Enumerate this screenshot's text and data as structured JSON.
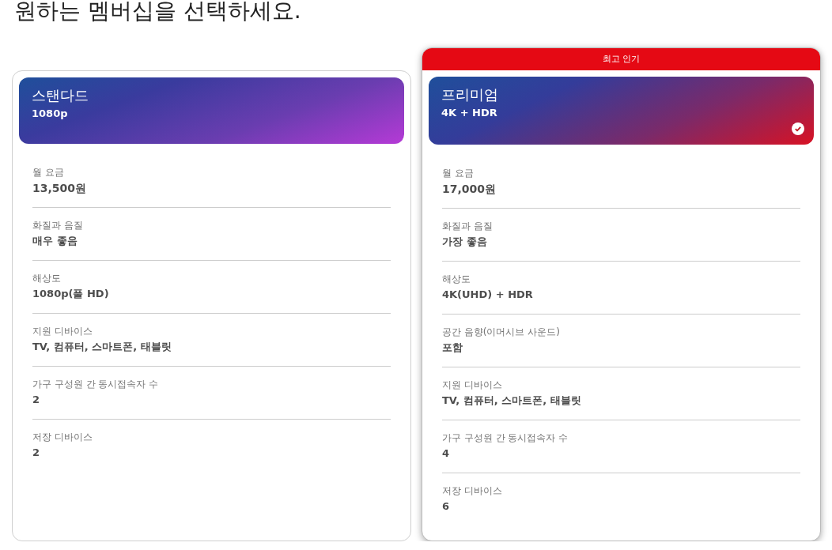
{
  "heading": "원하는 멤버십을 선택하세요.",
  "plans": [
    {
      "kind": "standard",
      "name": "스탠다드",
      "resolution": "1080p",
      "selected": false,
      "rows": [
        {
          "label": "월 요금",
          "value": "13,500원",
          "kind": "price"
        },
        {
          "label": "화질과 음질",
          "value": "매우 좋음"
        },
        {
          "label": "해상도",
          "value": "1080p(풀 HD)"
        },
        {
          "label": "지원 디바이스",
          "value": "TV, 컴퓨터, 스마트폰, 태블릿"
        },
        {
          "label": "가구 구성원 간 동시접속자 수",
          "value": "2"
        },
        {
          "label": "저장 디바이스",
          "value": "2"
        }
      ]
    },
    {
      "kind": "premium",
      "badge": "최고 인기",
      "name": "프리미엄",
      "resolution": "4K + HDR",
      "selected": true,
      "rows": [
        {
          "label": "월 요금",
          "value": "17,000원",
          "kind": "price"
        },
        {
          "label": "화질과 음질",
          "value": "가장 좋음"
        },
        {
          "label": "해상도",
          "value": "4K(UHD) + HDR"
        },
        {
          "label": "공간 음향(이머시브 사운드)",
          "value": "포함"
        },
        {
          "label": "지원 디바이스",
          "value": "TV, 컴퓨터, 스마트폰, 태블릿"
        },
        {
          "label": "가구 구성원 간 동시접속자 수",
          "value": "4"
        },
        {
          "label": "저장 디바이스",
          "value": "6"
        }
      ]
    }
  ]
}
